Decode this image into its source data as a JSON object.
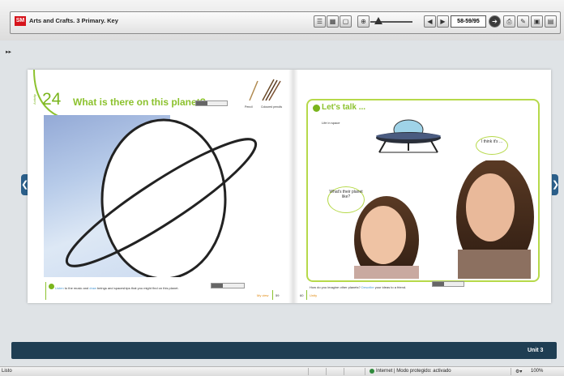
{
  "toolbar": {
    "logo_text": "SM",
    "title": "Arts and Crafts. 3 Primary. Key",
    "page_indicator": "58-59/95",
    "prev_label": "◀",
    "next_label": "▶"
  },
  "left_page": {
    "activity_label": "Activity",
    "activity_number": "24",
    "heading": "What is there on this planet?",
    "tool_labels": [
      "Pencil",
      "Coloured pencils"
    ],
    "instruction_parts": [
      "Listen",
      " to the music and ",
      "draw",
      " beings and spaceships that you might find on this planet."
    ],
    "footer_label": "My view",
    "page_number": "59"
  },
  "right_page": {
    "section_title": "Let's talk ...",
    "subtitle": "Life in space",
    "bubble_left": "What's their planet like?",
    "bubble_right": "I think it's ...",
    "instruction_parts": [
      "How do you imagine other planets? ",
      "Describe",
      " your ideas to a friend."
    ],
    "page_number": "60",
    "footer_label": "Unity"
  },
  "unit_label": "Unit 3",
  "statusbar": {
    "left_text": "Listo",
    "zone_text": "Internet | Modo protegido: activado",
    "zoom_text": "100%"
  },
  "colors": {
    "accent_green": "#8cc22e",
    "unit_bar": "#1f3e53",
    "link_blue": "#4a98d3"
  }
}
